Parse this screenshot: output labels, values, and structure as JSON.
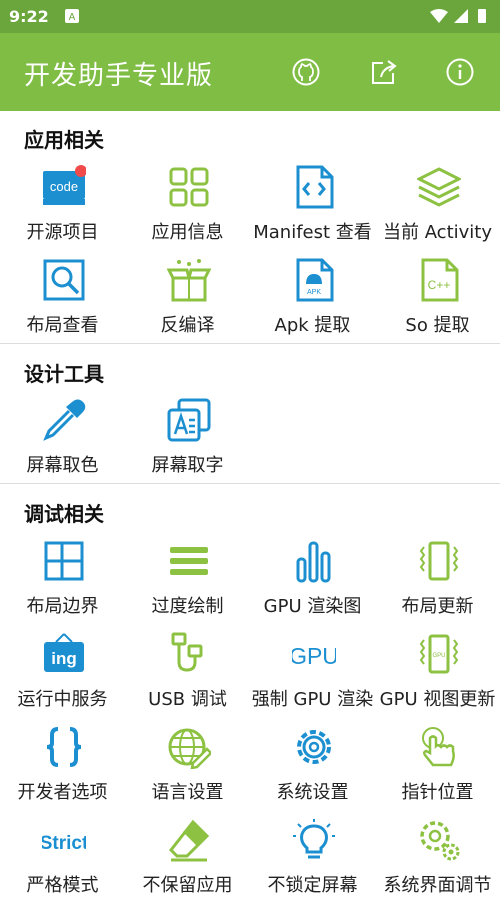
{
  "status_bar": {
    "time": "9:22",
    "notif": "A"
  },
  "app_bar": {
    "title": "开发助手专业版"
  },
  "sections": [
    {
      "title": "应用相关",
      "items": [
        "开源项目",
        "应用信息",
        "Manifest 查看",
        "当前 Activity",
        "布局查看",
        "反编译",
        "Apk 提取",
        "So 提取"
      ]
    },
    {
      "title": "设计工具",
      "items": [
        "屏幕取色",
        "屏幕取字"
      ]
    },
    {
      "title": "调试相关",
      "items": [
        "布局边界",
        "过度绘制",
        "GPU 渲染图",
        "布局更新",
        "运行中服务",
        "USB 调试",
        "强制 GPU 渲染",
        "GPU 视图更新",
        "开发者选项",
        "语言设置",
        "系统设置",
        "指针位置",
        "严格模式",
        "不保留应用",
        "不锁定屏幕",
        "系统界面调节"
      ]
    }
  ],
  "icon_text": {
    "code": "code",
    "apk": "APK",
    "cpp": "C++",
    "gpu": "GPU",
    "ing": "ing",
    "strict": "Strict",
    "gpu_small": "GPU"
  },
  "colors": {
    "blue": "#1c8fd1",
    "green": "#8cc142",
    "appbar": "#80bd45",
    "statusbar": "#6aa63c",
    "badge": "#f04a4a"
  }
}
